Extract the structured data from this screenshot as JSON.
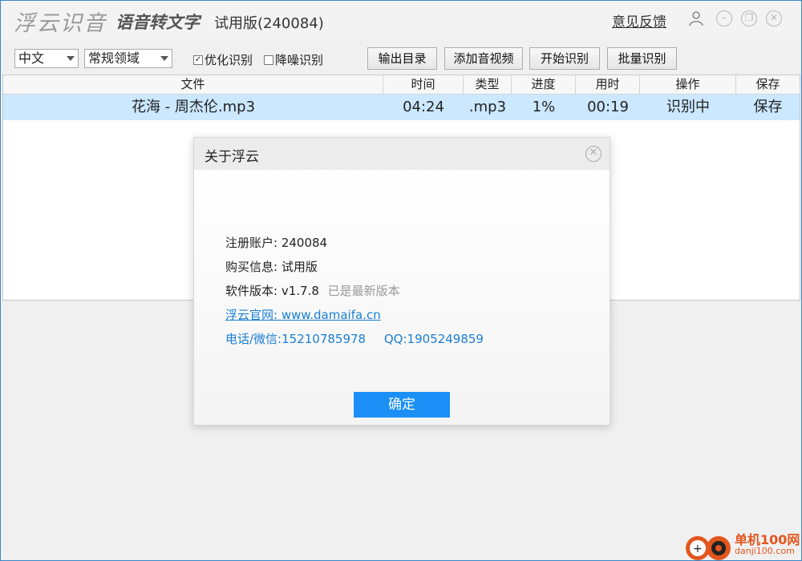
{
  "titlebar": {
    "logo": "浮云识音",
    "subtitle": "语音转文字",
    "version": "试用版(240084)",
    "feedback": "意见反馈",
    "icons": [
      "user-icon",
      "minimize-icon",
      "restore-icon",
      "close-icon"
    ]
  },
  "toolbar": {
    "language": "中文",
    "domain": "常规领域",
    "optimize": {
      "label": "优化识别",
      "checked": true
    },
    "denoise": {
      "label": "降噪识别",
      "checked": false
    },
    "buttons": {
      "output_dir": "输出目录",
      "add_media": "添加音视频",
      "start": "开始识别",
      "batch": "批量识别"
    }
  },
  "table": {
    "headers": [
      "文件",
      "时间",
      "类型",
      "进度",
      "用时",
      "操作",
      "保存"
    ],
    "rows": [
      {
        "file": "花海 - 周杰伦.mp3",
        "time": "04:24",
        "type": ".mp3",
        "progress": "1%",
        "elapsed": "00:19",
        "action": "识别中",
        "save": "保存"
      }
    ]
  },
  "dialog": {
    "title": "关于浮云",
    "account_label": "注册账户:",
    "account_value": "240084",
    "purchase_label": "购买信息:",
    "purchase_value": "试用版",
    "version_label": "软件版本:",
    "version_value": "v1.7.8",
    "version_note": "已是最新版本",
    "website": "浮云官网: www.damaifa.cn",
    "phone": "电话/微信:15210785978",
    "qq": "QQ:1905249859",
    "ok": "确定"
  },
  "watermark": {
    "line1": "单机100网",
    "line2": "danji100.com"
  },
  "colors": {
    "selected_row": "#cce8ff",
    "accent": "#1b8ff5",
    "link": "#1a7fd3",
    "watermark": "#e2561e"
  }
}
